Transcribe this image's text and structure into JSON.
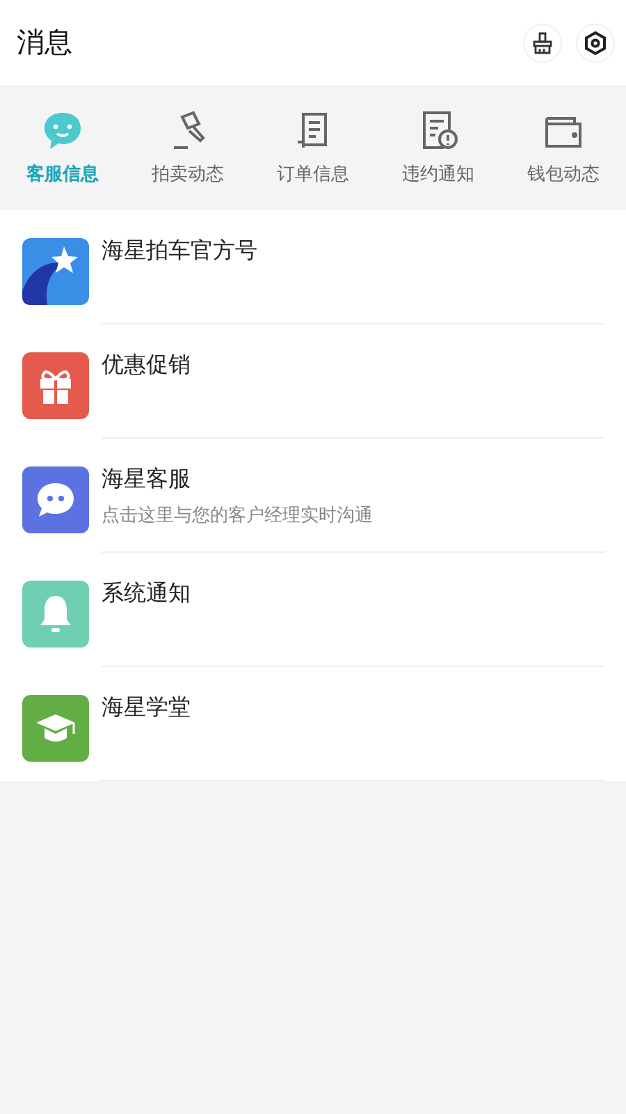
{
  "header": {
    "title": "消息"
  },
  "tabs": [
    {
      "label": "客服信息",
      "kind": "smile",
      "selected": true
    },
    {
      "label": "拍卖动态",
      "kind": "gavel",
      "selected": false
    },
    {
      "label": "订单信息",
      "kind": "scroll",
      "selected": false
    },
    {
      "label": "违约通知",
      "kind": "alert",
      "selected": false
    },
    {
      "label": "钱包动态",
      "kind": "wallet",
      "selected": false
    }
  ],
  "messages": [
    {
      "title": "海星拍车官方号",
      "kind": "star",
      "color": "#3a8ee6"
    },
    {
      "title": "优惠促销",
      "kind": "gift",
      "color": "#e45a4c"
    },
    {
      "title": "海星客服",
      "subtitle": "点击这里与您的客户经理实时沟通",
      "kind": "chat",
      "color": "#5b72e0"
    },
    {
      "title": "系统通知",
      "kind": "bell",
      "color": "#6fcfb2"
    },
    {
      "title": "海星学堂",
      "kind": "cap",
      "color": "#63ad45"
    }
  ]
}
